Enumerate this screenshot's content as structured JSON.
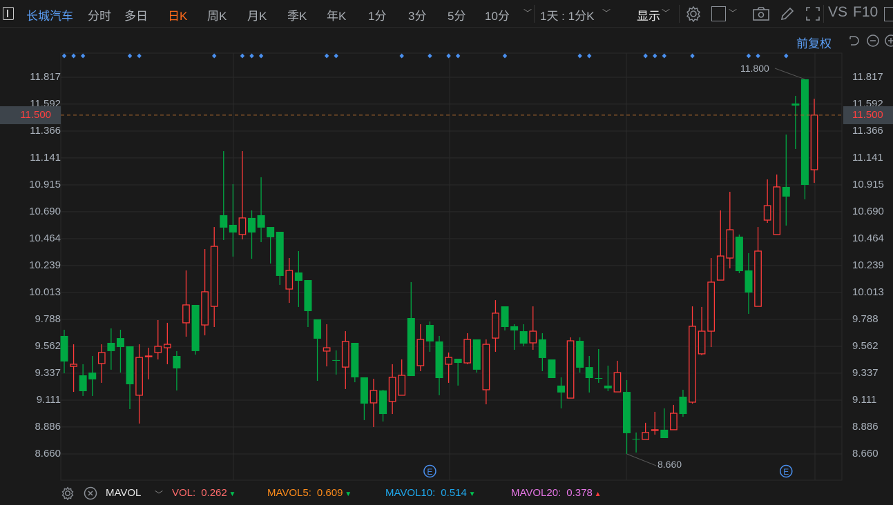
{
  "toolbar": {
    "stock_name": "长城汽车",
    "tabs": [
      {
        "label": "分时",
        "active": false
      },
      {
        "label": "多日",
        "active": false
      },
      {
        "label": "日K",
        "active": true
      },
      {
        "label": "周K",
        "active": false
      },
      {
        "label": "月K",
        "active": false
      },
      {
        "label": "季K",
        "active": false
      },
      {
        "label": "年K",
        "active": false
      },
      {
        "label": "1分",
        "active": false
      },
      {
        "label": "3分",
        "active": false
      },
      {
        "label": "5分",
        "active": false
      },
      {
        "label": "10分",
        "active": false
      }
    ],
    "period_select": "1天 : 1分K",
    "display_label": "显示",
    "vs_label": "VS",
    "f10_label": "F10",
    "icons": [
      "gear-icon",
      "square-icon",
      "camera-icon",
      "pencil-icon",
      "fullscreen-icon"
    ]
  },
  "subbar": {
    "adjust_label": "前复权"
  },
  "axis": {
    "price_ticks": [
      "11.817",
      "11.592",
      "11.366",
      "11.141",
      "10.915",
      "10.690",
      "10.464",
      "10.239",
      "10.013",
      "9.788",
      "9.562",
      "9.337",
      "9.111",
      "8.886",
      "8.660"
    ],
    "current_price": "11.500"
  },
  "annotations": {
    "high_label": "11.800",
    "low_label": "8.660",
    "event_marker": "E"
  },
  "indicator_bar": {
    "name": "MAVOL",
    "items": [
      {
        "label": "VOL:",
        "value": "0.262",
        "dir": "down",
        "color": "#ff6b6b"
      },
      {
        "label": "MAVOL5:",
        "value": "0.609",
        "dir": "down",
        "color": "#ff8c1a"
      },
      {
        "label": "MAVOL10:",
        "value": "0.514",
        "dir": "down",
        "color": "#1ea7ec"
      },
      {
        "label": "MAVOL20:",
        "value": "0.378",
        "dir": "up",
        "color": "#e676e6"
      }
    ]
  },
  "colors": {
    "up": "#ff3b3b",
    "down": "#00a843",
    "accent": "#5b9ef5",
    "active_tab": "#ff6a1a"
  },
  "chart_data": {
    "type": "candlestick",
    "ylim": [
      8.66,
      11.817
    ],
    "last_price": 11.5,
    "ohlc": [
      [
        9.649,
        9.701,
        9.336,
        9.435
      ],
      [
        9.394,
        9.579,
        9.18,
        9.412
      ],
      [
        9.319,
        9.412,
        9.146,
        9.186
      ],
      [
        9.342,
        9.481,
        9.146,
        9.285
      ],
      [
        9.418,
        9.579,
        9.256,
        9.51
      ],
      [
        9.591,
        9.712,
        9.366,
        9.522
      ],
      [
        9.631,
        9.701,
        9.342,
        9.556
      ],
      [
        9.562,
        9.562,
        9.036,
        9.244
      ],
      [
        9.152,
        9.579,
        8.915,
        9.469
      ],
      [
        9.475,
        9.55,
        9.285,
        9.481
      ],
      [
        9.51,
        9.782,
        9.452,
        9.562
      ],
      [
        9.55,
        9.759,
        9.412,
        9.579
      ],
      [
        9.481,
        9.522,
        9.192,
        9.377
      ],
      [
        9.759,
        10.198,
        9.643,
        9.909
      ],
      [
        9.909,
        9.909,
        9.493,
        9.522
      ],
      [
        9.741,
        10.377,
        9.654,
        10.019
      ],
      [
        9.897,
        10.562,
        9.724,
        10.4
      ],
      [
        10.661,
        11.198,
        10.453,
        10.557
      ],
      [
        10.58,
        10.921,
        10.314,
        10.516
      ],
      [
        10.499,
        11.198,
        10.458,
        10.638
      ],
      [
        10.638,
        10.701,
        10.296,
        10.516
      ],
      [
        10.661,
        10.979,
        10.435,
        10.557
      ],
      [
        10.562,
        10.562,
        10.256,
        10.476
      ],
      [
        10.522,
        10.522,
        10.077,
        10.152
      ],
      [
        10.042,
        10.302,
        9.926,
        10.198
      ],
      [
        10.181,
        10.36,
        9.892,
        10.111
      ],
      [
        10.117,
        10.117,
        9.724,
        9.857
      ],
      [
        9.788,
        9.788,
        9.273,
        9.626
      ],
      [
        9.522,
        9.747,
        9.394,
        9.55
      ],
      [
        9.447,
        9.528,
        9.325,
        9.441
      ],
      [
        9.388,
        9.689,
        9.204,
        9.603
      ],
      [
        9.591,
        9.591,
        9.261,
        9.302
      ],
      [
        9.302,
        9.302,
        8.944,
        9.082
      ],
      [
        9.088,
        9.29,
        8.886,
        9.192
      ],
      [
        9.192,
        9.198,
        8.932,
        8.995
      ],
      [
        9.1,
        9.412,
        8.995,
        9.302
      ],
      [
        9.152,
        9.452,
        9.152,
        9.319
      ],
      [
        9.799,
        10.1,
        9.313,
        9.313
      ],
      [
        9.4,
        9.747,
        9.354,
        9.62
      ],
      [
        9.741,
        9.77,
        9.516,
        9.603
      ],
      [
        9.603,
        9.649,
        9.152,
        9.296
      ],
      [
        9.412,
        9.51,
        9.256,
        9.469
      ],
      [
        9.458,
        9.458,
        9.233,
        9.423
      ],
      [
        9.423,
        9.672,
        9.412,
        9.62
      ],
      [
        9.62,
        9.62,
        9.342,
        9.366
      ],
      [
        9.198,
        9.62,
        9.076,
        9.579
      ],
      [
        9.631,
        9.949,
        9.516,
        9.84
      ],
      [
        9.897,
        9.897,
        9.695,
        9.724
      ],
      [
        9.73,
        9.747,
        9.533,
        9.695
      ],
      [
        9.689,
        9.747,
        9.562,
        9.585
      ],
      [
        9.591,
        9.897,
        9.533,
        9.689
      ],
      [
        9.62,
        9.672,
        9.354,
        9.464
      ],
      [
        9.452,
        9.452,
        9.296,
        9.296
      ],
      [
        9.233,
        9.302,
        9.042,
        9.175
      ],
      [
        9.128,
        9.637,
        9.128,
        9.608
      ],
      [
        9.608,
        9.637,
        9.342,
        9.383
      ],
      [
        9.388,
        9.481,
        9.175,
        9.296
      ],
      [
        9.296,
        9.539,
        9.256,
        9.29
      ],
      [
        9.233,
        9.4,
        9.186,
        9.209
      ],
      [
        9.18,
        9.441,
        9.18,
        9.342
      ],
      [
        9.18,
        9.279,
        8.66,
        8.834
      ],
      [
        8.787,
        8.84,
        8.672,
        8.782
      ],
      [
        8.782,
        8.921,
        8.782,
        8.84
      ],
      [
        8.857,
        9.013,
        8.822,
        8.863
      ],
      [
        8.863,
        9.042,
        8.793,
        8.793
      ],
      [
        8.863,
        9.071,
        8.863,
        9.001
      ],
      [
        9.14,
        9.198,
        8.972,
        8.995
      ],
      [
        9.094,
        9.897,
        9.082,
        9.73
      ],
      [
        9.499,
        9.892,
        9.487,
        9.689
      ],
      [
        9.689,
        10.302,
        9.556,
        10.1
      ],
      [
        10.117,
        10.701,
        10.117,
        10.319
      ],
      [
        10.302,
        10.857,
        10.215,
        10.539
      ],
      [
        10.481,
        10.499,
        10.175,
        10.192
      ],
      [
        10.198,
        10.343,
        9.834,
        10.013
      ],
      [
        9.897,
        10.562,
        9.897,
        10.36
      ],
      [
        10.62,
        10.961,
        10.597,
        10.741
      ],
      [
        10.499,
        11.002,
        10.499,
        10.898
      ],
      [
        10.898,
        11.337,
        10.574,
        10.817
      ],
      [
        11.597,
        11.661,
        11.216,
        11.58
      ],
      [
        11.8,
        11.8,
        10.794,
        10.915
      ],
      [
        11.042,
        11.637,
        10.932,
        11.5
      ]
    ],
    "dot_markers": [
      1,
      2,
      3,
      8,
      9,
      17,
      20,
      21,
      22,
      29,
      30,
      37,
      40,
      42,
      43,
      48,
      56,
      57,
      63,
      64,
      65,
      68,
      74,
      75,
      78
    ],
    "event_markers": [
      40,
      78
    ],
    "high_index": 80,
    "low_index": 61
  }
}
